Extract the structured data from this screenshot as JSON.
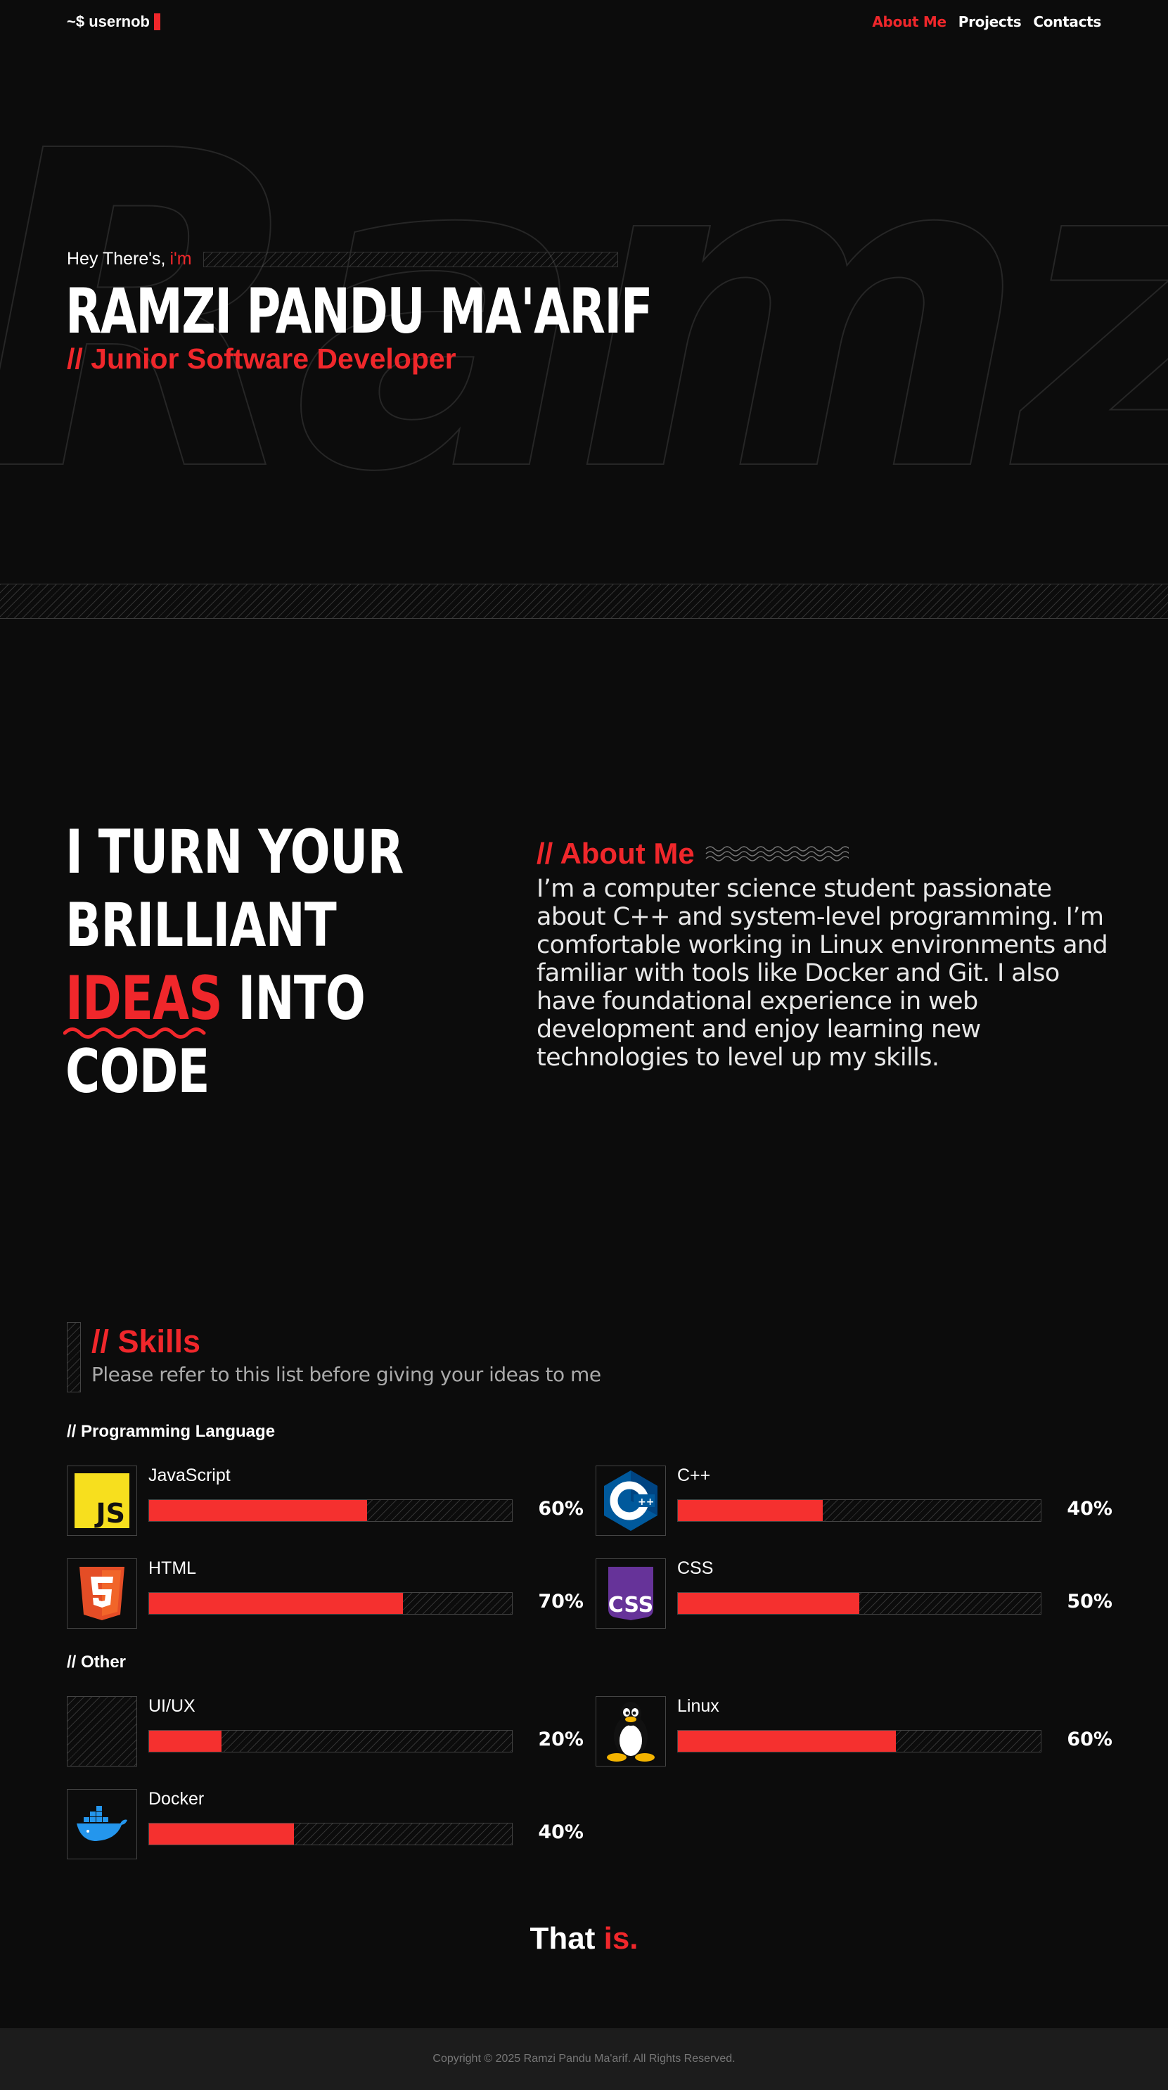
{
  "nav": {
    "logo": "~$ usernob",
    "links": [
      {
        "label": "About Me",
        "active": true
      },
      {
        "label": "Projects",
        "active": false
      },
      {
        "label": "Contacts",
        "active": false
      }
    ]
  },
  "hero": {
    "background_text": "Ramz",
    "greeting": "Hey There's,",
    "greeting_accent": "i'm",
    "name": "RAMZI PANDU MA'ARIF",
    "role": "// Junior Software Developer"
  },
  "tagline": {
    "line1": "I TURN YOUR",
    "line2": "BRILLIANT",
    "line3_accent": "IDEAS",
    "line3_rest": " INTO",
    "line4": "CODE"
  },
  "about": {
    "title": "// About Me",
    "text": "I’m a computer science student passionate about C++ and system-level programming. I’m comfortable working in Linux environments and familiar with tools like Docker and Git. I also have foundational experience in web development and enjoy learning new technologies to level up my skills."
  },
  "skills": {
    "title": "// Skills",
    "subtitle": "Please refer to this list before giving your ideas to me",
    "groups": [
      {
        "title": "// Programming Language",
        "items": [
          {
            "name": "JavaScript",
            "percent": "60%",
            "level": 0.6,
            "icon": "javascript-icon"
          },
          {
            "name": "C++",
            "percent": "40%",
            "level": 0.4,
            "icon": "cpp-icon"
          },
          {
            "name": "HTML",
            "percent": "70%",
            "level": 0.7,
            "icon": "html5-icon"
          },
          {
            "name": "CSS",
            "percent": "50%",
            "level": 0.5,
            "icon": "css-icon"
          }
        ]
      },
      {
        "title": "// Other",
        "items": [
          {
            "name": "UI/UX",
            "percent": "20%",
            "level": 0.2,
            "icon": "none"
          },
          {
            "name": "Linux",
            "percent": "60%",
            "level": 0.6,
            "icon": "linux-tux-icon"
          },
          {
            "name": "Docker",
            "percent": "40%",
            "level": 0.4,
            "icon": "docker-icon"
          }
        ]
      }
    ]
  },
  "outro": {
    "text": "That",
    "accent": "is."
  },
  "footer": {
    "copyright": "Copyright © 2025 Ramzi Pandu Ma'arif. All Rights Reserved."
  },
  "colors": {
    "accent": "#f0272b",
    "background": "#0c0c0c",
    "footer": "#1c1c1c"
  }
}
